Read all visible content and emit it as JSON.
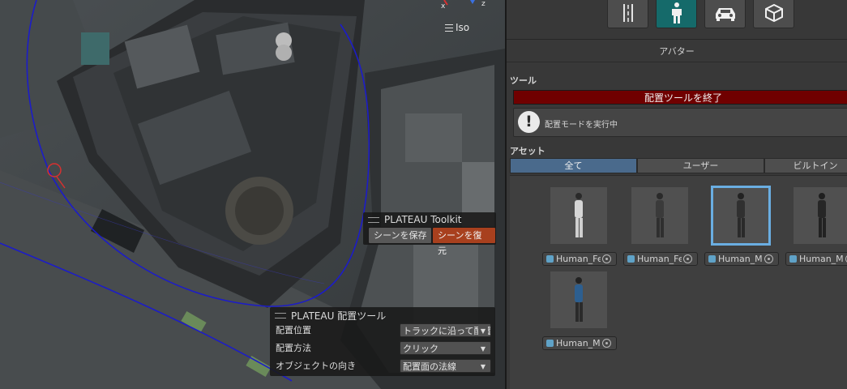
{
  "scene": {
    "gizmo_x": "x",
    "gizmo_z": "z",
    "projection_label": "Iso"
  },
  "toolkit_overlay": {
    "title": "PLATEAU Toolkit",
    "save_button": "シーンを保存",
    "restore_button": "シーンを復元"
  },
  "placement_overlay": {
    "title": "PLATEAU 配置ツール",
    "rows": [
      {
        "label": "配置位置",
        "value": "トラックに沿って配置"
      },
      {
        "label": "配置方法",
        "value": "クリック"
      },
      {
        "label": "オブジェクトの向き",
        "value": "配置面の法線"
      }
    ]
  },
  "panel": {
    "categories": [
      {
        "icon": "road-icon",
        "active": false
      },
      {
        "icon": "person-icon",
        "active": true
      },
      {
        "icon": "car-icon",
        "active": false
      },
      {
        "icon": "box-icon",
        "active": false
      }
    ],
    "category_title": "アバター",
    "tool_section": "ツール",
    "end_tool_button": "配置ツールを終了",
    "help_message": "配置モードを実行中",
    "asset_section": "アセット",
    "tabs": [
      "全て",
      "ユーザー",
      "ビルトイン"
    ],
    "active_tab": "全て",
    "assets": [
      {
        "name": "Human_Fe",
        "selected": false
      },
      {
        "name": "Human_Fe",
        "selected": false
      },
      {
        "name": "Human_Ma",
        "selected": true
      },
      {
        "name": "Human_Ma",
        "selected": false
      },
      {
        "name": "Human_Ma",
        "selected": false
      }
    ]
  },
  "colors": {
    "active_category": "#156a6a",
    "end_button": "#700000",
    "active_tab": "#4a6a8c",
    "selection_outline": "#6aaee2",
    "restore_button": "#a8401e"
  }
}
